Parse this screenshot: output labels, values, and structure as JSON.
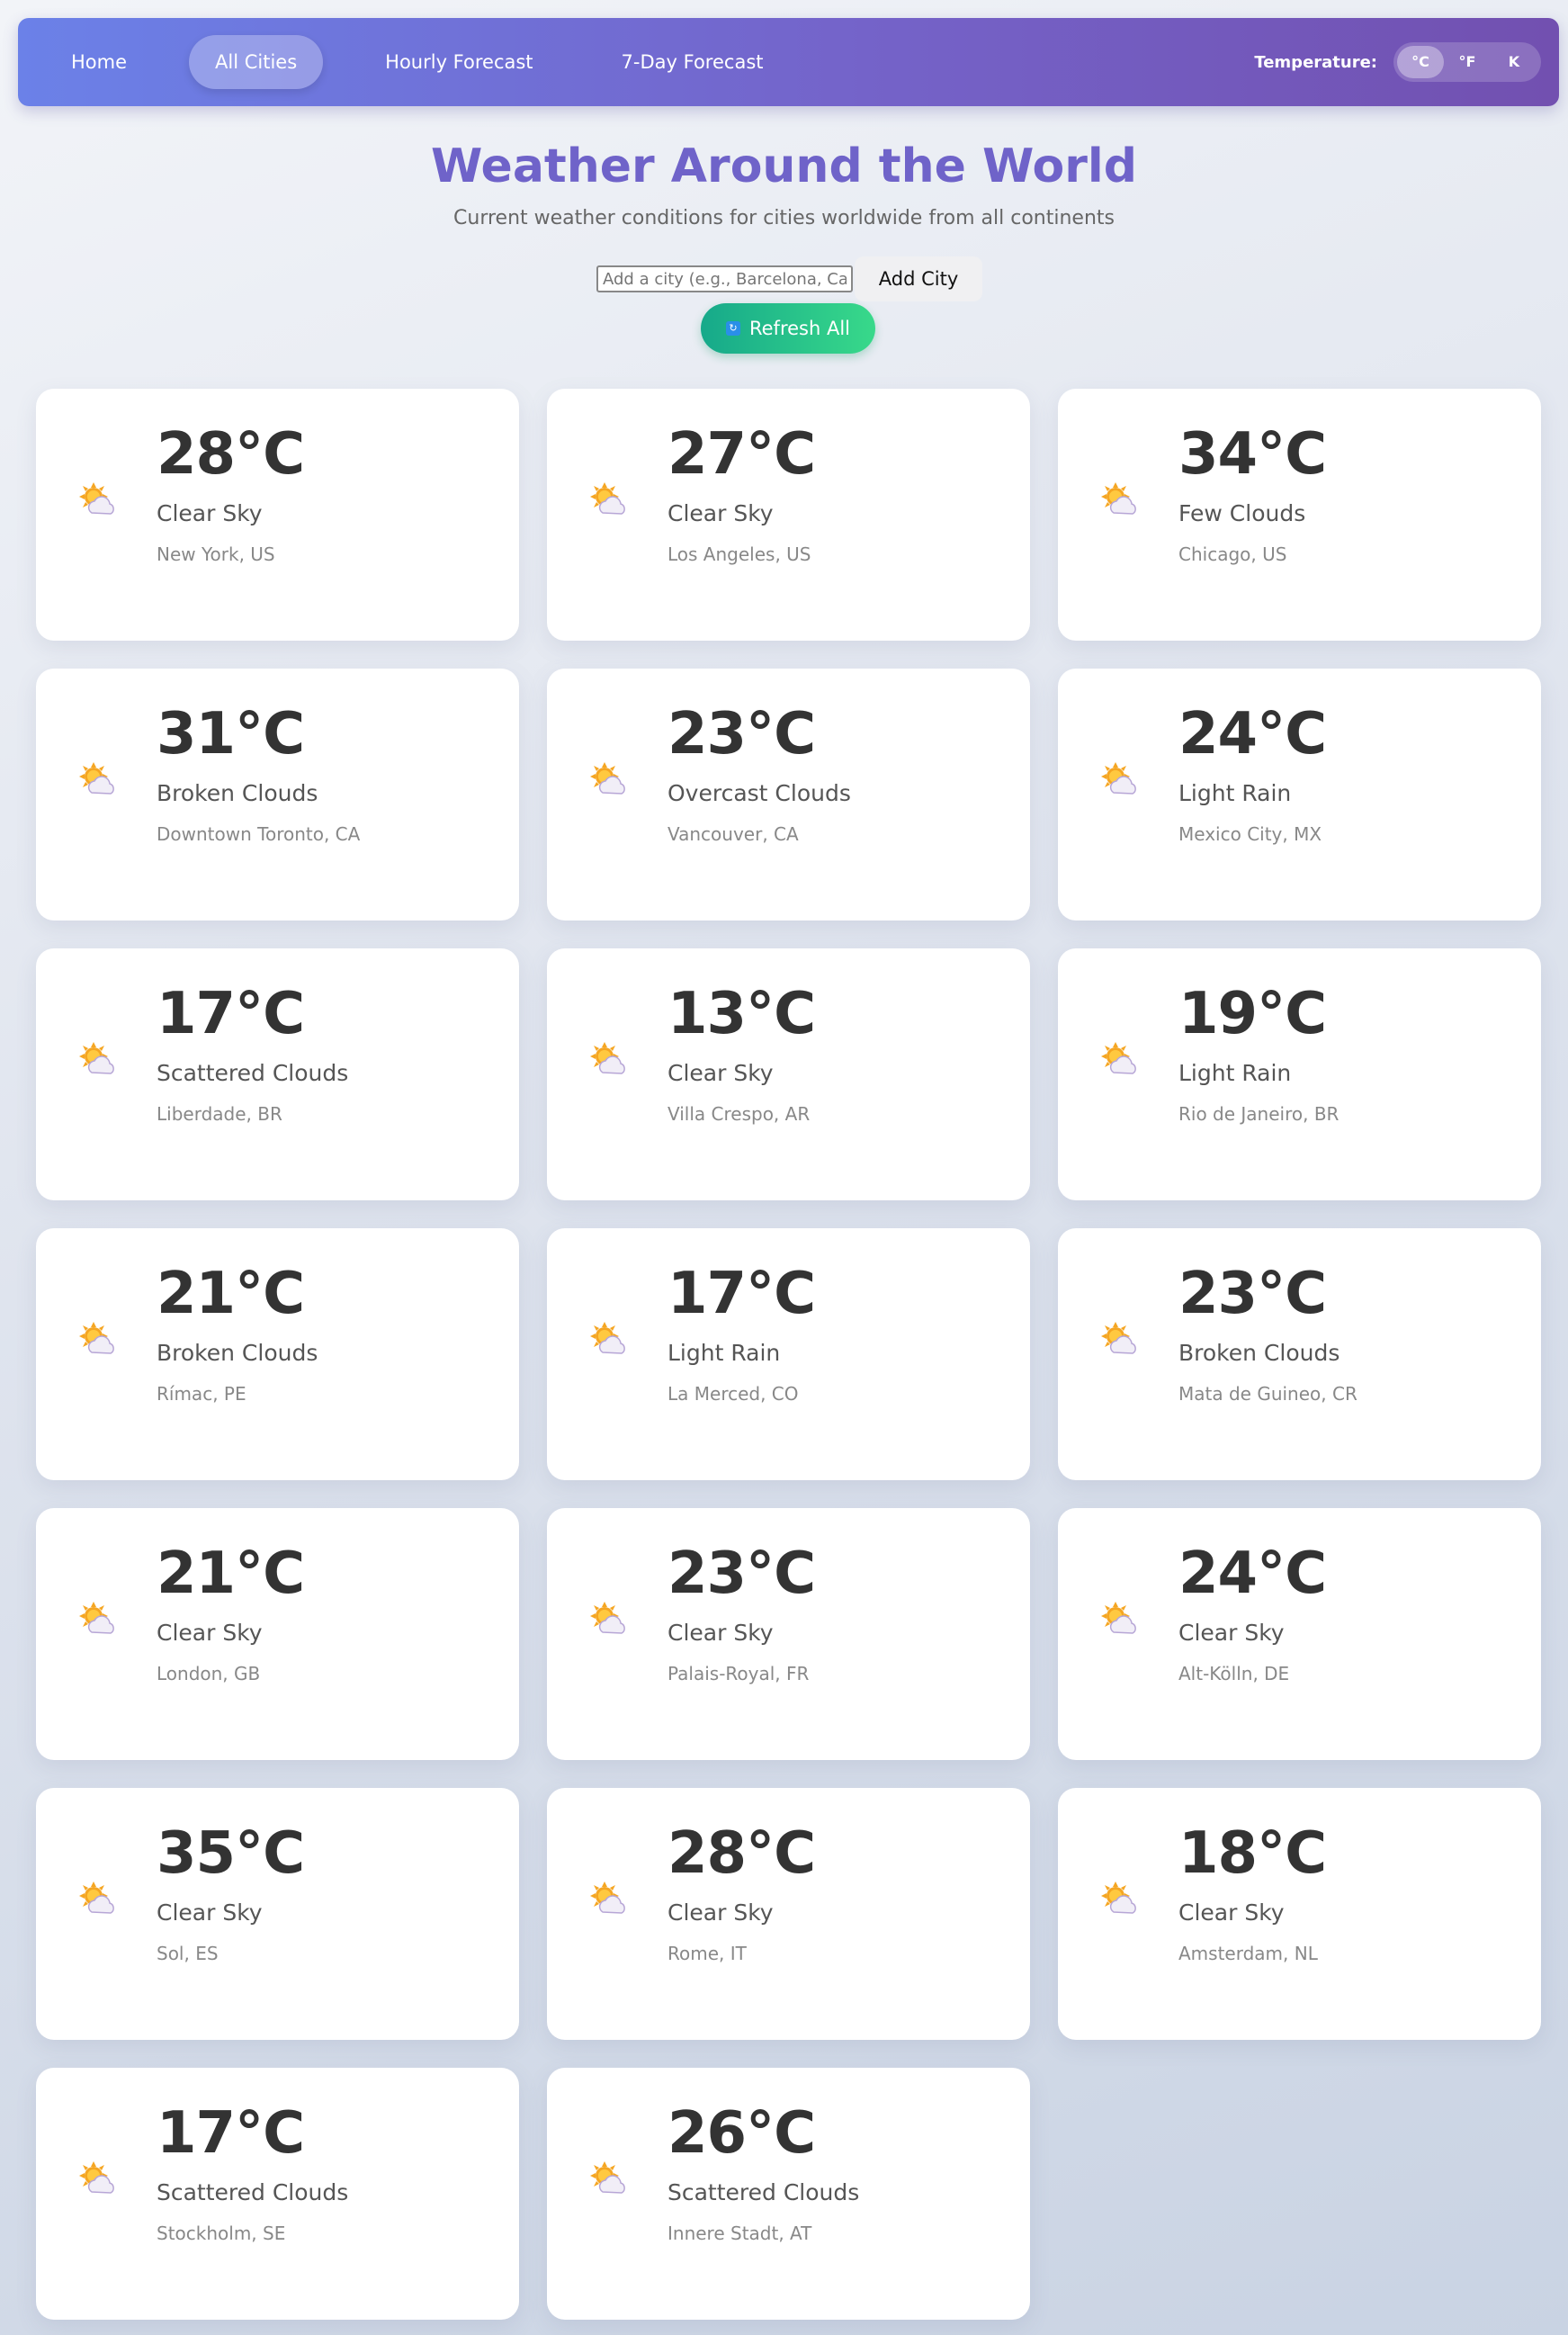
{
  "nav": {
    "links": [
      "Home",
      "All Cities",
      "Hourly Forecast",
      "7-Day Forecast"
    ],
    "active": "All Cities",
    "temperature_label": "Temperature:",
    "units": [
      "°C",
      "°F",
      "K"
    ],
    "active_unit": "°C"
  },
  "header": {
    "title": "Weather Around the World",
    "subtitle": "Current weather conditions for cities worldwide from all continents"
  },
  "controls": {
    "city_input_placeholder": "Add a city (e.g., Barcelona, Cairo)",
    "add_city_label": "Add City",
    "refresh_label": "Refresh All",
    "refresh_icon": "refresh-icon"
  },
  "cards": [
    {
      "temp": "28°C",
      "desc": "Clear Sky",
      "location": "New York, US",
      "icon": "partly-cloudy-icon"
    },
    {
      "temp": "27°C",
      "desc": "Clear Sky",
      "location": "Los Angeles, US",
      "icon": "partly-cloudy-icon"
    },
    {
      "temp": "34°C",
      "desc": "Few Clouds",
      "location": "Chicago, US",
      "icon": "partly-cloudy-icon"
    },
    {
      "temp": "31°C",
      "desc": "Broken Clouds",
      "location": "Downtown Toronto, CA",
      "icon": "partly-cloudy-icon"
    },
    {
      "temp": "23°C",
      "desc": "Overcast Clouds",
      "location": "Vancouver, CA",
      "icon": "partly-cloudy-icon"
    },
    {
      "temp": "24°C",
      "desc": "Light Rain",
      "location": "Mexico City, MX",
      "icon": "partly-cloudy-icon"
    },
    {
      "temp": "17°C",
      "desc": "Scattered Clouds",
      "location": "Liberdade, BR",
      "icon": "partly-cloudy-icon"
    },
    {
      "temp": "13°C",
      "desc": "Clear Sky",
      "location": "Villa Crespo, AR",
      "icon": "partly-cloudy-icon"
    },
    {
      "temp": "19°C",
      "desc": "Light Rain",
      "location": "Rio de Janeiro, BR",
      "icon": "partly-cloudy-icon"
    },
    {
      "temp": "21°C",
      "desc": "Broken Clouds",
      "location": "Rímac, PE",
      "icon": "partly-cloudy-icon"
    },
    {
      "temp": "17°C",
      "desc": "Light Rain",
      "location": "La Merced, CO",
      "icon": "partly-cloudy-icon"
    },
    {
      "temp": "23°C",
      "desc": "Broken Clouds",
      "location": "Mata de Guineo, CR",
      "icon": "partly-cloudy-icon"
    },
    {
      "temp": "21°C",
      "desc": "Clear Sky",
      "location": "London, GB",
      "icon": "partly-cloudy-icon"
    },
    {
      "temp": "23°C",
      "desc": "Clear Sky",
      "location": "Palais-Royal, FR",
      "icon": "partly-cloudy-icon"
    },
    {
      "temp": "24°C",
      "desc": "Clear Sky",
      "location": "Alt-Kölln, DE",
      "icon": "partly-cloudy-icon"
    },
    {
      "temp": "35°C",
      "desc": "Clear Sky",
      "location": "Sol, ES",
      "icon": "partly-cloudy-icon"
    },
    {
      "temp": "28°C",
      "desc": "Clear Sky",
      "location": "Rome, IT",
      "icon": "partly-cloudy-icon"
    },
    {
      "temp": "18°C",
      "desc": "Clear Sky",
      "location": "Amsterdam, NL",
      "icon": "partly-cloudy-icon"
    },
    {
      "temp": "17°C",
      "desc": "Scattered Clouds",
      "location": "Stockholm, SE",
      "icon": "partly-cloudy-icon"
    },
    {
      "temp": "26°C",
      "desc": "Scattered Clouds",
      "location": "Innere Stadt, AT",
      "icon": "partly-cloudy-icon"
    }
  ],
  "colors": {
    "nav_gradient_start": "#6b81e8",
    "nav_gradient_end": "#7250b0",
    "title": "#6f63c9",
    "refresh_gradient_start": "#16a98a",
    "refresh_gradient_end": "#38d98a"
  }
}
